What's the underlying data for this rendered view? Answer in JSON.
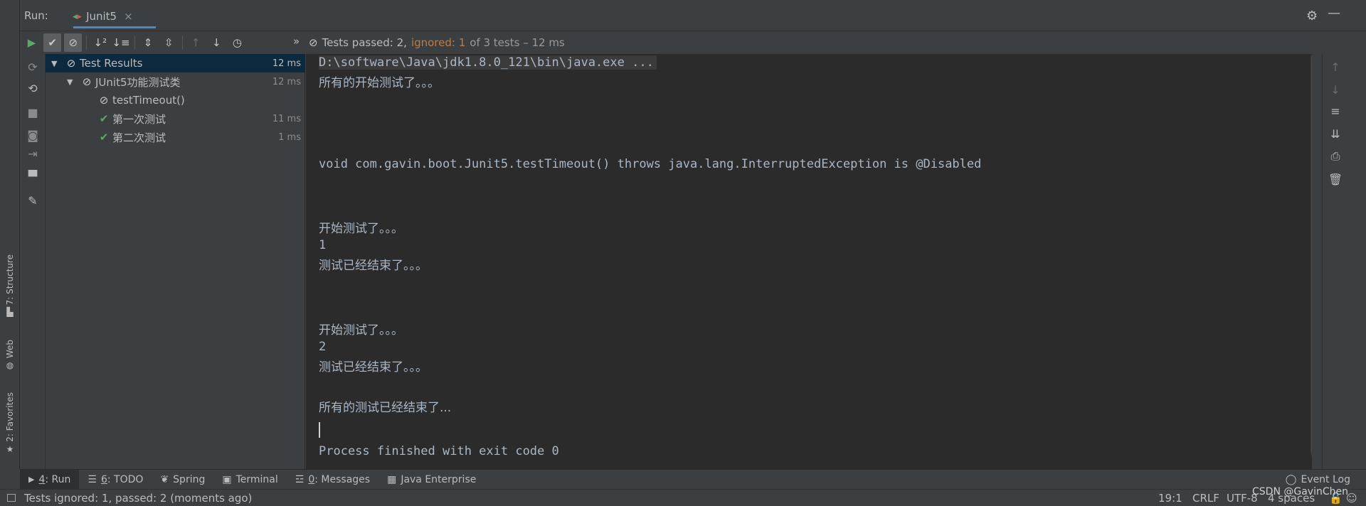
{
  "left_strip": {
    "tabs": [
      {
        "label": "7: Structure",
        "icon": "structure-icon"
      },
      {
        "label": "Web",
        "icon": "globe-icon"
      },
      {
        "label": "2: Favorites",
        "icon": "star-icon"
      }
    ]
  },
  "run_header": {
    "label": "Run:",
    "tab_name": "Junit5",
    "tab_close": "×"
  },
  "toolbar": {
    "status_prefix": "Tests passed: 2,",
    "status_ignored": "ignored: 1",
    "status_suffix": "of 3 tests – 12 ms",
    "colors": {
      "ignored": "#c07a42",
      "pass": "#59a869"
    }
  },
  "tree": {
    "rows": [
      {
        "label": "Test Results",
        "time": "12 ms",
        "status": "ignored"
      },
      {
        "label": "JUnit5功能测试类",
        "time": "12 ms",
        "status": "ignored"
      },
      {
        "label": "testTimeout()",
        "time": "",
        "status": "ignored"
      },
      {
        "label": "第一次测试",
        "time": "11 ms",
        "status": "pass"
      },
      {
        "label": "第二次测试",
        "time": "1 ms",
        "status": "pass"
      }
    ]
  },
  "console": {
    "lines": [
      "D:\\software\\Java\\jdk1.8.0_121\\bin\\java.exe ...",
      "所有的开始测试了。。。",
      "void com.gavin.boot.Junit5.testTimeout() throws java.lang.InterruptedException is @Disabled",
      "开始测试了。。。",
      "1",
      "测试已经结束了。。。",
      "开始测试了。。。",
      "2",
      "测试已经结束了。。。",
      "所有的测试已经结束了...",
      "Process finished with exit code 0"
    ]
  },
  "bottom_bar": {
    "tabs": [
      {
        "num": "4",
        "label": ": Run"
      },
      {
        "num": "6",
        "label": ": TODO"
      },
      {
        "num": "",
        "label": "Spring"
      },
      {
        "num": "",
        "label": "Terminal"
      },
      {
        "num": "0",
        "label": ": Messages"
      },
      {
        "num": "",
        "label": "Java Enterprise"
      }
    ],
    "event_log": "Event Log"
  },
  "status_bar": {
    "message": "Tests ignored: 1, passed: 2 (moments ago)",
    "position": "19:1",
    "line_sep": "CRLF",
    "encoding": "UTF-8",
    "indent": "4 spaces",
    "watermark": "CSDN @GavinChen"
  }
}
